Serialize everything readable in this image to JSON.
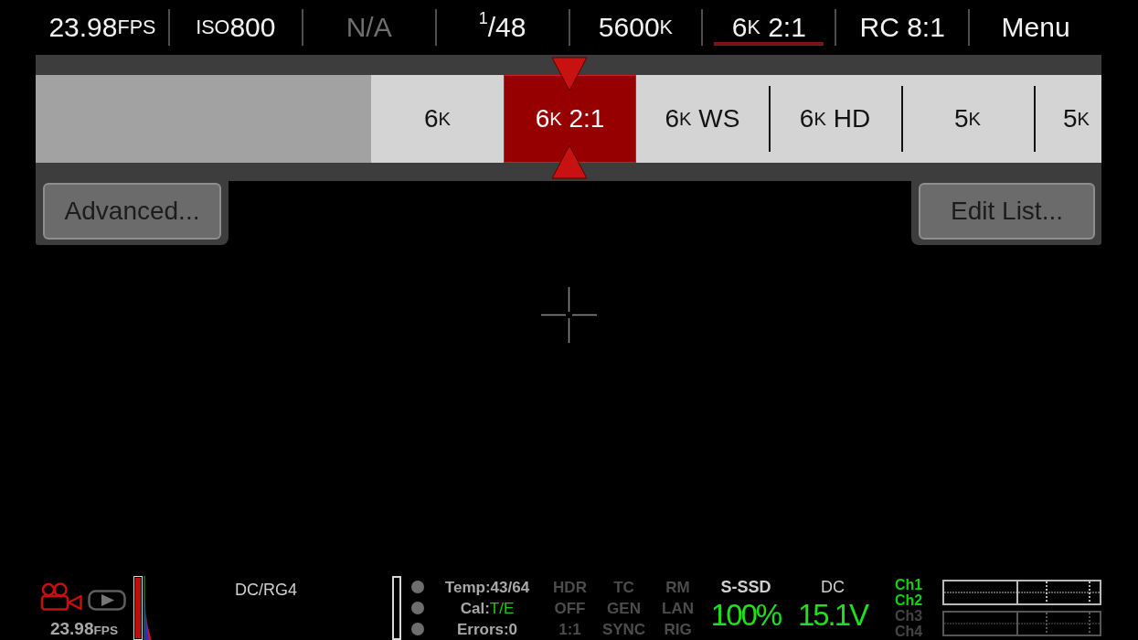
{
  "top_bar": {
    "items": [
      {
        "segments": [
          {
            "kind": "num",
            "text": "23.98"
          },
          {
            "kind": "unit",
            "text": "FPS"
          }
        ],
        "selected": false,
        "disabled": false
      },
      {
        "segments": [
          {
            "kind": "unit",
            "text": "ISO"
          },
          {
            "kind": "num",
            "text": "800"
          }
        ],
        "selected": false,
        "disabled": false
      },
      {
        "segments": [
          {
            "kind": "num",
            "text": "N/A"
          }
        ],
        "selected": false,
        "disabled": true
      },
      {
        "segments": [
          {
            "kind": "sup",
            "text": "1"
          },
          {
            "kind": "num",
            "text": "/48"
          }
        ],
        "selected": false,
        "disabled": false
      },
      {
        "segments": [
          {
            "kind": "num",
            "text": "5600"
          },
          {
            "kind": "unit",
            "text": "K"
          }
        ],
        "selected": false,
        "disabled": false
      },
      {
        "segments": [
          {
            "kind": "num",
            "text": "6"
          },
          {
            "kind": "unit",
            "text": "K"
          },
          {
            "kind": "num",
            "text": " 2:1"
          }
        ],
        "selected": true,
        "disabled": false
      },
      {
        "segments": [
          {
            "kind": "num",
            "text": "RC 8:1"
          }
        ],
        "selected": false,
        "disabled": false
      },
      {
        "segments": [
          {
            "kind": "num",
            "text": "Menu"
          }
        ],
        "selected": false,
        "disabled": false
      }
    ]
  },
  "format_picker": {
    "options": [
      {
        "segments": [
          {
            "kind": "num",
            "text": "6"
          },
          {
            "kind": "unit",
            "text": "K"
          }
        ],
        "selected": false
      },
      {
        "segments": [
          {
            "kind": "num",
            "text": "6"
          },
          {
            "kind": "unit",
            "text": "K"
          },
          {
            "kind": "num",
            "text": " 2:1"
          }
        ],
        "selected": true
      },
      {
        "segments": [
          {
            "kind": "num",
            "text": "6"
          },
          {
            "kind": "unit",
            "text": "K"
          },
          {
            "kind": "num",
            "text": " WS"
          }
        ],
        "selected": false
      },
      {
        "segments": [
          {
            "kind": "num",
            "text": "6"
          },
          {
            "kind": "unit",
            "text": "K"
          },
          {
            "kind": "num",
            "text": " HD"
          }
        ],
        "selected": false
      },
      {
        "segments": [
          {
            "kind": "num",
            "text": "5"
          },
          {
            "kind": "unit",
            "text": "K"
          }
        ],
        "selected": false
      },
      {
        "segments": [
          {
            "kind": "num",
            "text": "5"
          },
          {
            "kind": "unit",
            "text": "K"
          }
        ],
        "selected": false
      }
    ],
    "advanced_button": {
      "label": "Advanced..."
    },
    "edit_list_button": {
      "label": "Edit List..."
    }
  },
  "status_bar": {
    "record": {
      "fps": [
        {
          "kind": "num",
          "text": "23.98"
        },
        {
          "kind": "unit",
          "text": "FPS"
        }
      ]
    },
    "record_meter": {
      "level": 1
    },
    "codec": "DC/RG4",
    "status_lines": [
      {
        "label": "Temp:",
        "value": "43/64",
        "highlighted": false
      },
      {
        "label": "Cal:",
        "value": "T/E",
        "highlighted": true
      },
      {
        "label": "Errors:",
        "value": "0",
        "highlighted": false
      }
    ],
    "modes": [
      {
        "items": [
          "HDR",
          "OFF",
          "1:1"
        ],
        "disabled": true
      },
      {
        "items": [
          "TC",
          "GEN",
          "SYNC"
        ],
        "disabled": true
      },
      {
        "items": [
          "RM",
          "LAN",
          "RIG"
        ],
        "disabled": true
      }
    ],
    "media": {
      "label": "S-SSD",
      "value": "100%"
    },
    "power": {
      "label": "DC",
      "value": "15.1V"
    },
    "audio_channels": [
      {
        "name": "Ch1",
        "enabled": true
      },
      {
        "name": "Ch2",
        "enabled": true
      },
      {
        "name": "Ch3",
        "enabled": false
      },
      {
        "name": "Ch4",
        "enabled": false
      }
    ]
  }
}
